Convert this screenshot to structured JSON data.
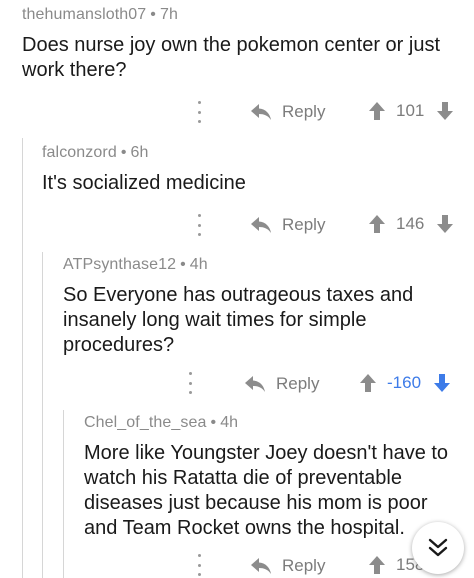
{
  "comments": [
    {
      "author": "thehumansloth07",
      "age": "7h",
      "text": "Does nurse joy own the pokemon center or just work there?",
      "reply_label": "Reply",
      "score": "101",
      "score_color": "#7c7c7c"
    },
    {
      "author": "falconzord",
      "age": "6h",
      "text": "It's socialized medicine",
      "reply_label": "Reply",
      "score": "146",
      "score_color": "#7c7c7c"
    },
    {
      "author": "ATPsynthase12",
      "age": "4h",
      "text": "So Everyone has outrageous taxes and insanely long wait times for simple procedures?",
      "reply_label": "Reply",
      "score": "-160",
      "score_color": "#3d7be8",
      "downvoted": true
    },
    {
      "author": "Chel_of_the_sea",
      "age": "4h",
      "text": "More like Youngster Joey doesn't have to watch his Ratatta die of preventable diseases just because his mom is poor and Team Rocket owns the hospital.",
      "reply_label": "Reply",
      "score": "158",
      "score_color": "#7c7c7c"
    }
  ],
  "separator": "•",
  "icons": {
    "more": "vertical-ellipsis-icon",
    "reply": "reply-arrow-icon",
    "upvote": "upvote-arrow-icon",
    "downvote": "downvote-arrow-icon",
    "fab": "double-chevron-down-icon"
  },
  "colors": {
    "text": "#1a1a1a",
    "meta": "#8a8a8a",
    "action": "#7c7c7c",
    "downvote_active": "#3d7be8",
    "thread_line": "#d6d6d6"
  }
}
